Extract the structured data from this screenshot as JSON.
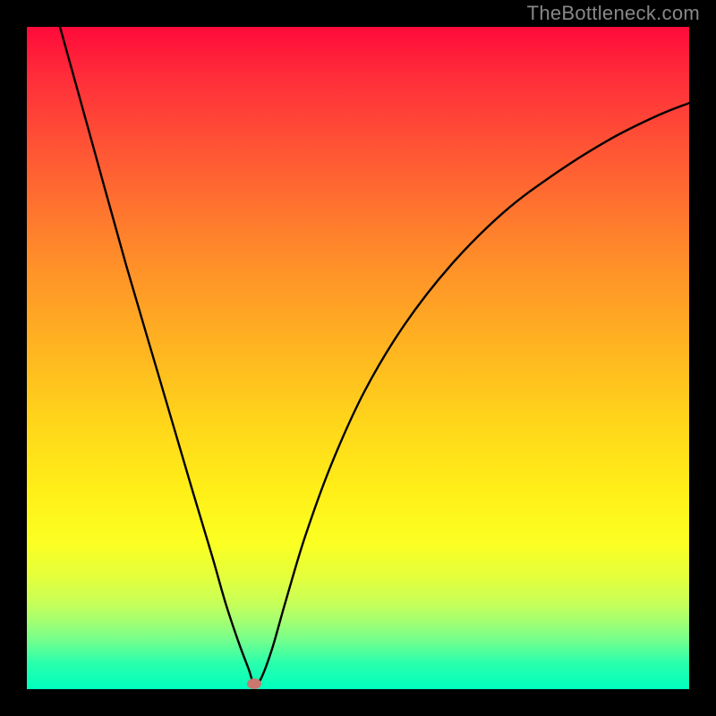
{
  "watermark": "TheBottleneck.com",
  "chart_data": {
    "type": "line",
    "title": "",
    "xlabel": "",
    "ylabel": "",
    "xlim": [
      0,
      100
    ],
    "ylim": [
      0,
      100
    ],
    "series": [
      {
        "name": "curve",
        "x": [
          5,
          10,
          15,
          20,
          25,
          28,
          30,
          32,
          33.5,
          34.3,
          35.3,
          37,
          39,
          42,
          46,
          51,
          57,
          64,
          72,
          80,
          88,
          95,
          100
        ],
        "values": [
          100,
          82,
          64,
          47,
          30,
          20,
          13,
          7,
          3,
          0.8,
          1.5,
          6,
          13,
          23,
          34,
          45,
          55,
          64,
          72,
          78,
          83,
          86.5,
          88.5
        ]
      }
    ],
    "annotations": [
      {
        "type": "marker",
        "name": "minimum-dot",
        "x": 34.3,
        "y": 0.8,
        "color": "#c9776f"
      }
    ],
    "background_gradient": {
      "orientation": "vertical",
      "stops": [
        {
          "pos": 0.0,
          "color": "#ff0a3a"
        },
        {
          "pos": 0.5,
          "color": "#ffc21c"
        },
        {
          "pos": 0.8,
          "color": "#f4ff2a"
        },
        {
          "pos": 1.0,
          "color": "#00ffbe"
        }
      ]
    }
  }
}
